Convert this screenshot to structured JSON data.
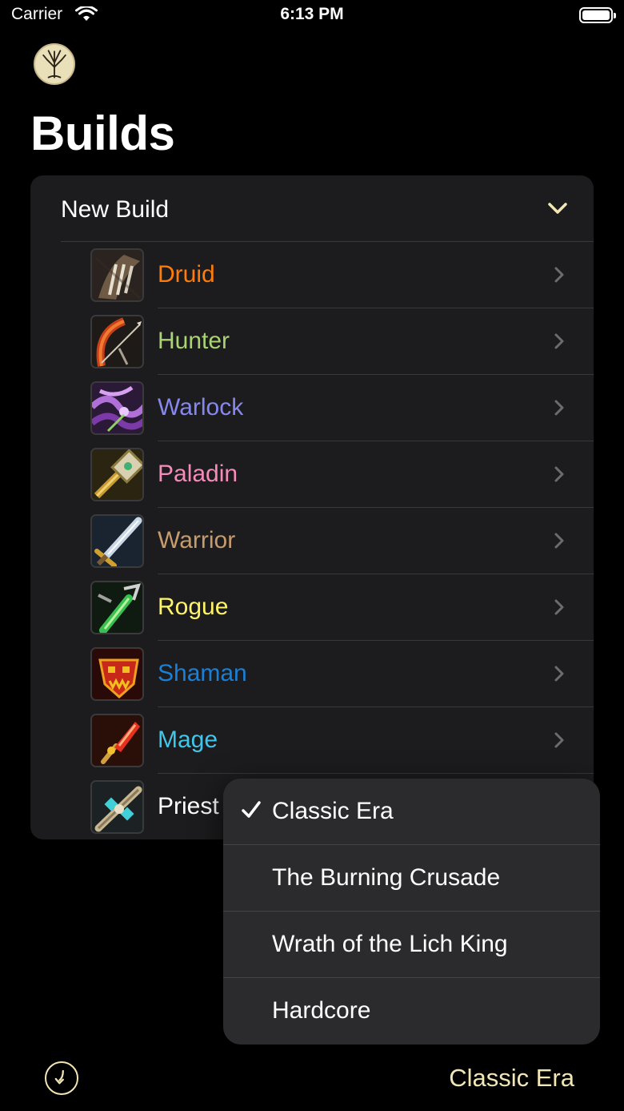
{
  "status_bar": {
    "carrier": "Carrier",
    "time": "6:13 PM"
  },
  "page": {
    "title": "Builds"
  },
  "section": {
    "header": "New Build",
    "expanded": true,
    "accent_color": "#f2e6b5"
  },
  "classes": [
    {
      "name": "Druid",
      "color": "#ff7c0a",
      "icon": "druid-class-icon"
    },
    {
      "name": "Hunter",
      "color": "#aad372",
      "icon": "hunter-class-icon"
    },
    {
      "name": "Warlock",
      "color": "#8788ee",
      "icon": "warlock-class-icon"
    },
    {
      "name": "Paladin",
      "color": "#f48cba",
      "icon": "paladin-class-icon"
    },
    {
      "name": "Warrior",
      "color": "#c69b6d",
      "icon": "warrior-class-icon"
    },
    {
      "name": "Rogue",
      "color": "#fff468",
      "icon": "rogue-class-icon"
    },
    {
      "name": "Shaman",
      "color": "#1a7fd6",
      "icon": "shaman-class-icon"
    },
    {
      "name": "Mage",
      "color": "#3fc7eb",
      "icon": "mage-class-icon"
    },
    {
      "name": "Priest",
      "color": "#ffffff",
      "icon": "priest-class-icon"
    }
  ],
  "version_menu": {
    "items": [
      "Classic Era",
      "The Burning Crusade",
      "Wrath of the Lich King",
      "Hardcore"
    ],
    "selected": "Classic Era"
  },
  "toolbar": {
    "current_version": "Classic Era"
  }
}
